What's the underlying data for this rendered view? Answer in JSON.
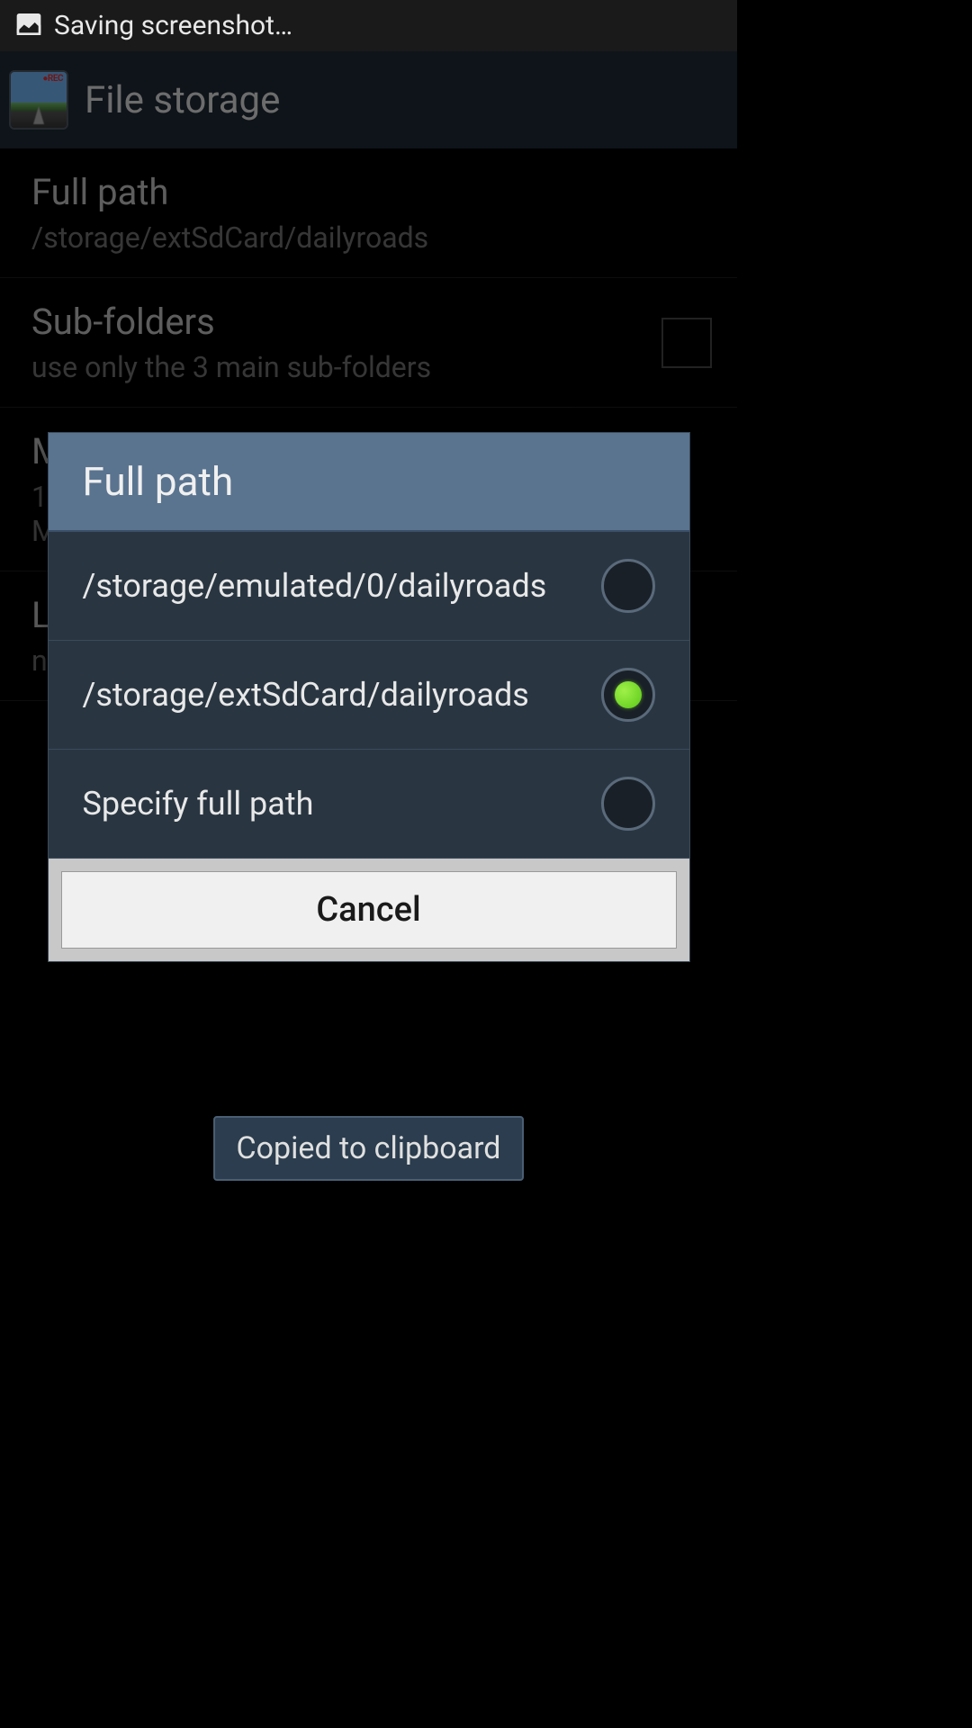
{
  "statusBar": {
    "text": "Saving screenshot…"
  },
  "appBar": {
    "title": "File storage"
  },
  "settings": {
    "fullPath": {
      "title": "Full path",
      "subtitle": "/storage/extSdCard/dailyroads"
    },
    "subFolders": {
      "title": "Sub-folders",
      "subtitle": "use only the 3 main sub-folders"
    },
    "item3": {
      "title": "M",
      "subtitle1": "1",
      "subtitle2": "M"
    },
    "item4": {
      "title": "L",
      "subtitle": "n"
    }
  },
  "dialog": {
    "title": "Full path",
    "options": [
      {
        "label": "/storage/emulated/0/dailyroads",
        "checked": false
      },
      {
        "label": "/storage/extSdCard/dailyroads",
        "checked": true
      },
      {
        "label": "Specify full path",
        "checked": false
      }
    ],
    "cancelLabel": "Cancel"
  },
  "toast": {
    "text": "Copied to clipboard"
  }
}
